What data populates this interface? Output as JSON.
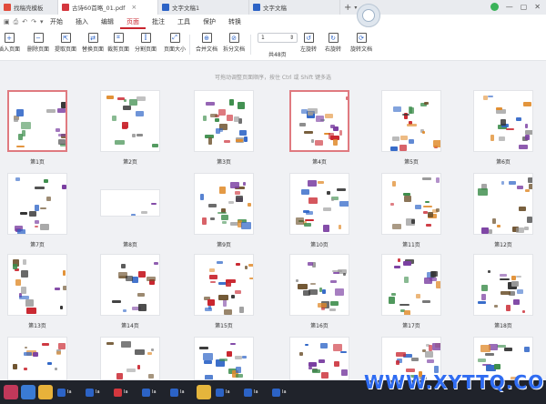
{
  "tabs": [
    {
      "label": "找稿壳模板",
      "color": "#e14b3b",
      "active": false
    },
    {
      "label": "古诗60首略_01.pdf",
      "color": "#d4373e",
      "active": true,
      "closable": true
    },
    {
      "label": "文字文稿1",
      "color": "#2c63c6",
      "active": false
    },
    {
      "label": "文字文稿",
      "color": "#2c63c6",
      "active": false
    }
  ],
  "tab_plus": "+",
  "tab_caret": "▾",
  "window_controls": [
    "—",
    "▢",
    "✕"
  ],
  "menu": {
    "items": [
      "开始",
      "插入",
      "编辑",
      "页面",
      "批注",
      "工具",
      "保护",
      "转换"
    ],
    "active": "页面"
  },
  "toolbar": {
    "buttons": [
      {
        "label": "插入页面",
        "glyph": "+"
      },
      {
        "label": "删除页面",
        "glyph": "−"
      },
      {
        "label": "提取页面",
        "glyph": "⇱"
      },
      {
        "label": "替换页面",
        "glyph": "⇄"
      },
      {
        "label": "裁剪页面",
        "glyph": "⌗"
      },
      {
        "label": "分割页面",
        "glyph": "⫿"
      },
      {
        "label": "页面大小",
        "glyph": "⤢"
      },
      {
        "label": "合并文档",
        "glyph": "⊕"
      },
      {
        "label": "拆分文档",
        "glyph": "⊘"
      },
      {
        "label": "左旋转",
        "glyph": "↺"
      },
      {
        "label": "右旋转",
        "glyph": "↻"
      },
      {
        "label": "旋转文档",
        "glyph": "⟳"
      }
    ],
    "page_input_value": "1",
    "page_total": "共48页"
  },
  "hint": "可拖动调整页面顺序，按住 Ctrl 或 Shift 键多选",
  "pages": [
    {
      "label": "第1页",
      "selected": true
    },
    {
      "label": "第2页",
      "selected": false
    },
    {
      "label": "第3页",
      "selected": false
    },
    {
      "label": "第4页",
      "selected": true
    },
    {
      "label": "第5页",
      "selected": false
    },
    {
      "label": "第6页",
      "selected": false
    },
    {
      "label": "第7页",
      "selected": false
    },
    {
      "label": "第8页",
      "selected": false
    },
    {
      "label": "第9页",
      "selected": false
    },
    {
      "label": "第10页",
      "selected": false
    },
    {
      "label": "第11页",
      "selected": false
    },
    {
      "label": "第12页",
      "selected": false
    },
    {
      "label": "第13页",
      "selected": false
    },
    {
      "label": "第14页",
      "selected": false
    },
    {
      "label": "第15页",
      "selected": false
    },
    {
      "label": "第16页",
      "selected": false
    },
    {
      "label": "第17页",
      "selected": false
    },
    {
      "label": "第18页",
      "selected": false
    },
    {
      "label": "",
      "selected": false
    },
    {
      "label": "",
      "selected": false
    },
    {
      "label": "",
      "selected": false
    },
    {
      "label": "",
      "selected": false
    },
    {
      "label": "",
      "selected": false
    },
    {
      "label": "",
      "selected": false
    }
  ],
  "taskbar": {
    "items": [
      {
        "icon": "app-icon",
        "color": "#c2385a",
        "label": ""
      },
      {
        "icon": "browser-icon",
        "color": "#3a7bd5",
        "label": ""
      },
      {
        "icon": "chrome-icon",
        "color": "#e8b23a",
        "label": ""
      },
      {
        "icon": "doc-icon",
        "color": "#2c63c6",
        "label": "Ia"
      },
      {
        "icon": "doc-icon",
        "color": "#2c63c6",
        "label": "Ia"
      },
      {
        "icon": "pdf-icon",
        "color": "#d4373e",
        "label": "Ia"
      },
      {
        "icon": "doc-icon",
        "color": "#2c63c6",
        "label": "Ia"
      },
      {
        "icon": "doc-icon",
        "color": "#2c63c6",
        "label": "Ia"
      },
      {
        "icon": "folder-icon",
        "color": "#e5b53c",
        "label": ""
      },
      {
        "icon": "doc-icon",
        "color": "#2c63c6",
        "label": "Ia"
      },
      {
        "icon": "doc-icon",
        "color": "#2c63c6",
        "label": "Ia"
      },
      {
        "icon": "doc-icon",
        "color": "#2c63c6",
        "label": "Ia"
      }
    ]
  },
  "watermark": "WWW.XYTTQ.COM"
}
